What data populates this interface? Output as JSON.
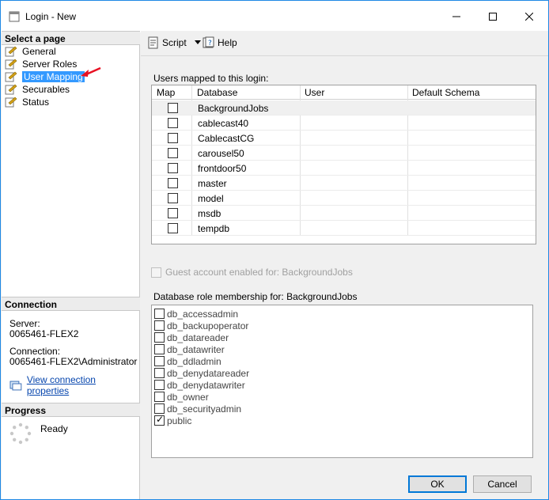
{
  "window": {
    "title": "Login - New"
  },
  "left_pane": {
    "select_page_header": "Select a page",
    "pages": [
      {
        "label": "General",
        "icon": "page-icon"
      },
      {
        "label": "Server Roles",
        "icon": "page-icon"
      },
      {
        "label": "User Mapping",
        "icon": "page-icon",
        "selected": true
      },
      {
        "label": "Securables",
        "icon": "page-icon"
      },
      {
        "label": "Status",
        "icon": "page-icon"
      }
    ],
    "connection_header": "Connection",
    "server_label": "Server:",
    "server_value": "0065461-FLEX2",
    "connection_label": "Connection:",
    "connection_value": "0065461-FLEX2\\Administrator",
    "view_props_link": "View connection properties",
    "progress_header": "Progress",
    "progress_status": "Ready"
  },
  "toolbar": {
    "script_label": "Script",
    "help_label": "Help"
  },
  "users_mapped": {
    "label": "Users mapped to this login:",
    "columns": [
      "Map",
      "Database",
      "User",
      "Default Schema"
    ],
    "rows": [
      {
        "map": false,
        "database": "BackgroundJobs",
        "user": "",
        "schema": ""
      },
      {
        "map": false,
        "database": "cablecast40",
        "user": "",
        "schema": ""
      },
      {
        "map": false,
        "database": "CablecastCG",
        "user": "",
        "schema": ""
      },
      {
        "map": false,
        "database": "carousel50",
        "user": "",
        "schema": ""
      },
      {
        "map": false,
        "database": "frontdoor50",
        "user": "",
        "schema": ""
      },
      {
        "map": false,
        "database": "master",
        "user": "",
        "schema": ""
      },
      {
        "map": false,
        "database": "model",
        "user": "",
        "schema": ""
      },
      {
        "map": false,
        "database": "msdb",
        "user": "",
        "schema": ""
      },
      {
        "map": false,
        "database": "tempdb",
        "user": "",
        "schema": ""
      }
    ]
  },
  "guest_account_label": "Guest account enabled for: BackgroundJobs",
  "role_membership": {
    "label": "Database role membership for: BackgroundJobs",
    "roles": [
      {
        "name": "db_accessadmin",
        "checked": false
      },
      {
        "name": "db_backupoperator",
        "checked": false
      },
      {
        "name": "db_datareader",
        "checked": false
      },
      {
        "name": "db_datawriter",
        "checked": false
      },
      {
        "name": "db_ddladmin",
        "checked": false
      },
      {
        "name": "db_denydatareader",
        "checked": false
      },
      {
        "name": "db_denydatawriter",
        "checked": false
      },
      {
        "name": "db_owner",
        "checked": false
      },
      {
        "name": "db_securityadmin",
        "checked": false
      },
      {
        "name": "public",
        "checked": true
      }
    ]
  },
  "buttons": {
    "ok": "OK",
    "cancel": "Cancel"
  },
  "colors": {
    "selection": "#3399ff",
    "accent": "#0078d7",
    "arrow": "#e81123"
  }
}
